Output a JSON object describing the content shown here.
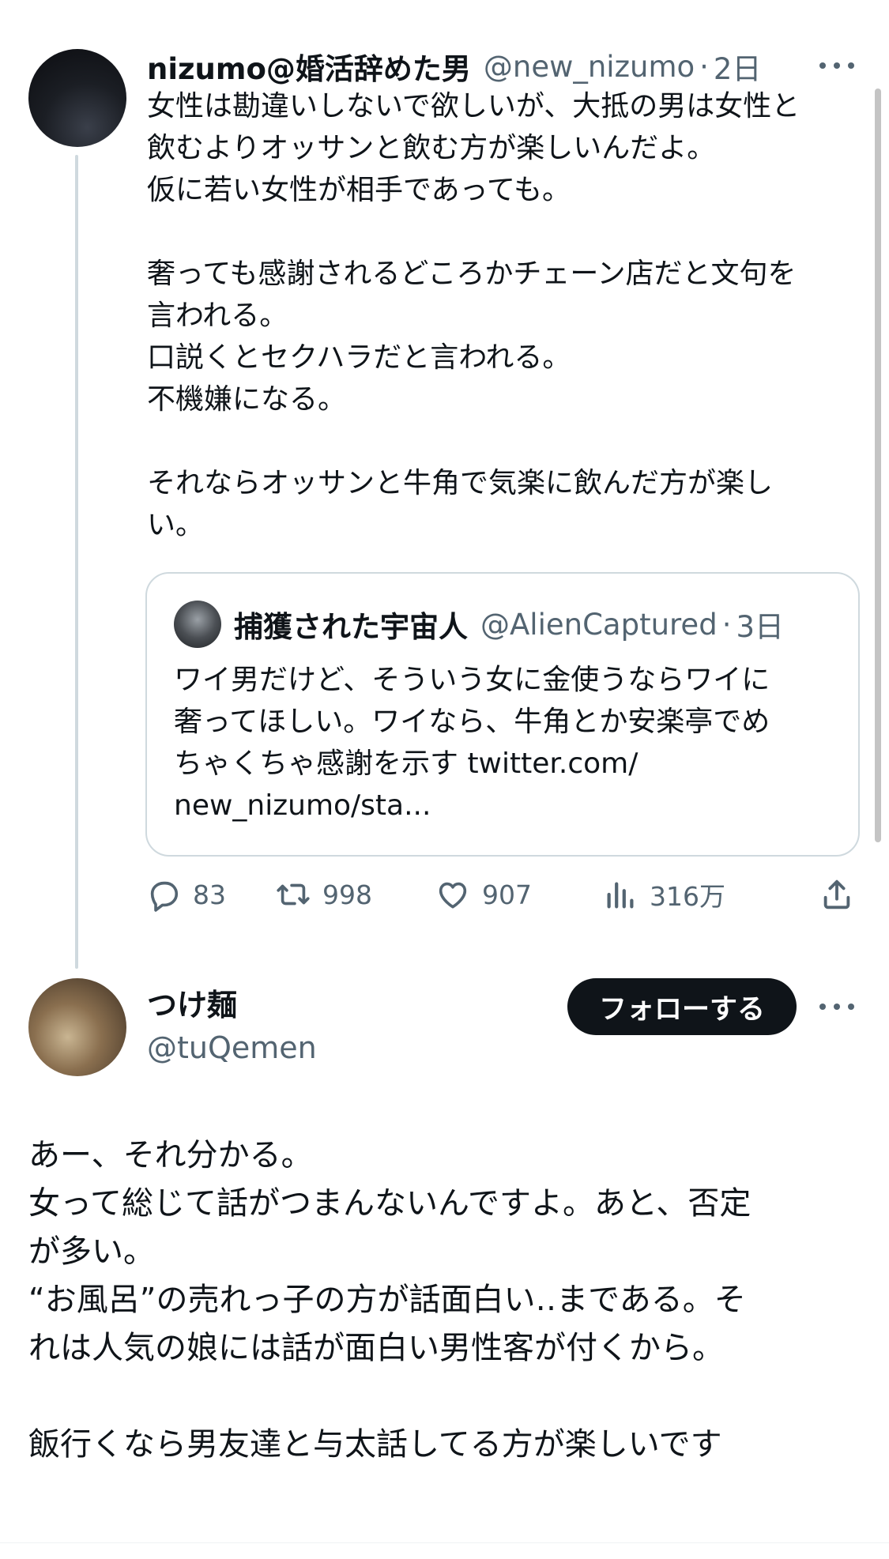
{
  "main_post": {
    "display_name": "nizumo@婚活辞めた男",
    "handle": "@new_nizumo",
    "separator": "·",
    "time": "2日",
    "lines": [
      "女性は勘違いしないで欲しいが、大抵の男は女性と",
      "飲むよりオッサンと飲む方が楽しいんだよ。",
      "仮に若い女性が相手であっても。",
      "",
      "奢っても感謝されるどころかチェーン店だと文句を",
      "言われる。",
      "口説くとセクハラだと言われる。",
      "不機嫌になる。",
      "",
      "それならオッサンと牛角で気楽に飲んだ方が楽し",
      "い。"
    ],
    "quoted": {
      "display_name": "捕獲された宇宙人",
      "handle": "@AlienCaptured",
      "separator": "·",
      "time": "3日",
      "lines": [
        "ワイ男だけど、そういう女に金使うならワイに",
        "奢ってほしい。ワイなら、牛角とか安楽亭でめ",
        "ちゃくちゃ感謝を示す twitter.com/",
        "new_nizumo/sta..."
      ]
    },
    "actions": {
      "replies": "83",
      "retweets": "998",
      "likes": "907",
      "views": "316万"
    }
  },
  "reply_post": {
    "display_name": "つけ麺",
    "handle": "@tuQemen",
    "follow_label": "フォローする",
    "lines": [
      "あー、それ分かる。",
      "女って総じて話がつまんないんですよ。あと、否定",
      "が多い。",
      "“お風呂”の売れっ子の方が話面白い‥まである。そ",
      "れは人気の娘には話が面白い男性客が付くから。",
      "",
      "飯行くなら男友達と与太話してる方が楽しいです"
    ]
  },
  "icons": {
    "more": "more-horizontal-icon",
    "reply": "reply-icon",
    "retweet": "retweet-icon",
    "like": "heart-icon",
    "views": "views-chart-icon",
    "share": "share-icon"
  },
  "colors": {
    "text": "#0f1419",
    "secondary": "#536471",
    "border": "#cfd9de",
    "follow_bg": "#0f1419"
  }
}
